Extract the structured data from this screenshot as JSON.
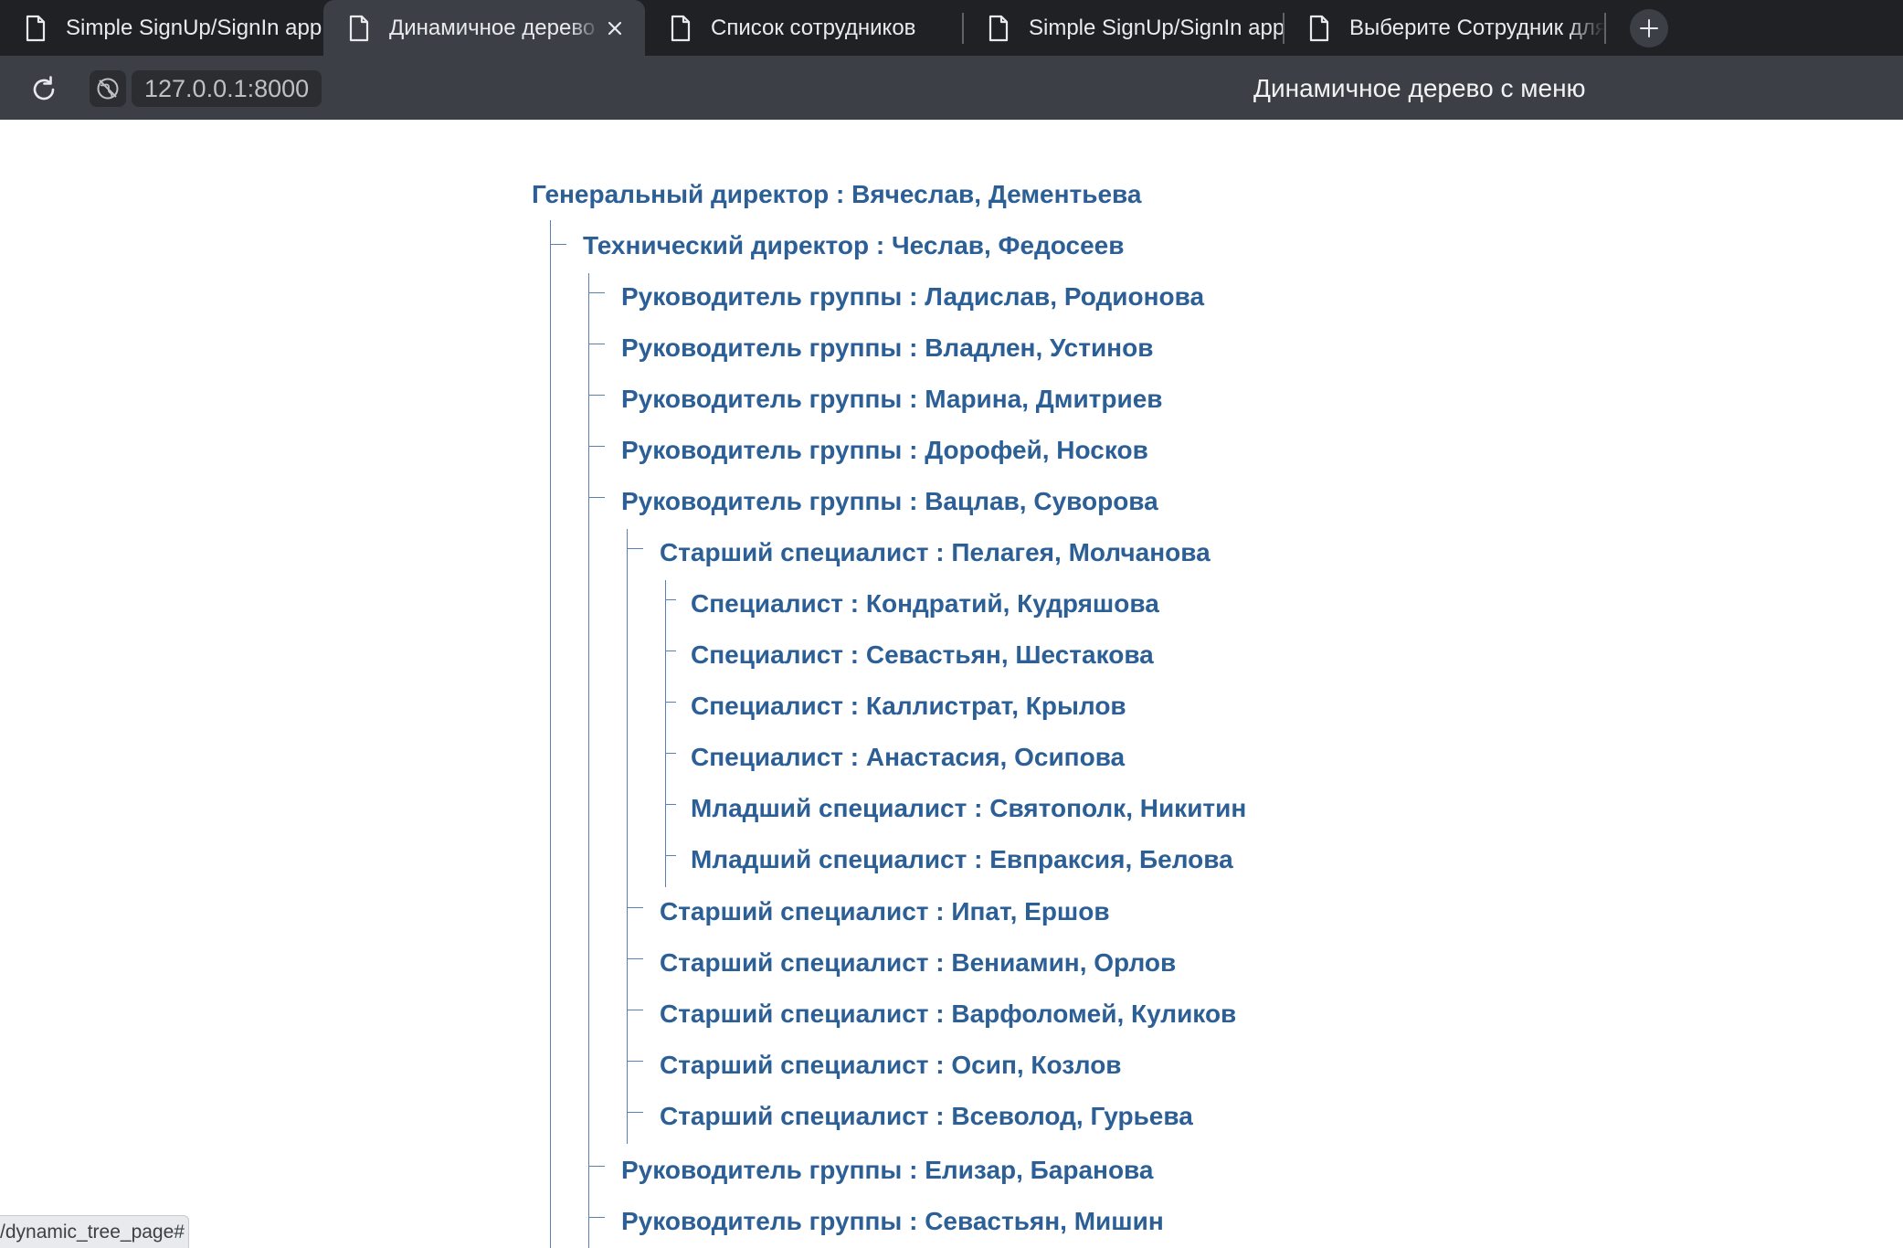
{
  "browser": {
    "tabs": [
      {
        "label": "Simple SignUp/SignIn app",
        "active": false
      },
      {
        "label": "Динамичное дерево с м",
        "active": true
      },
      {
        "label": "Список сотрудников",
        "active": false
      },
      {
        "label": "Simple SignUp/SignIn app",
        "active": false
      },
      {
        "label": "Выберите Сотрудник для и",
        "active": false
      }
    ],
    "url": "127.0.0.1:8000",
    "page_title": "Динамичное дерево с меню",
    "status_url": "/dynamic_tree_page#"
  },
  "tree": {
    "root": "Генеральный директор : Вячеслав, Дементьева",
    "cto": "Технический директор : Чеслав, Федосеев",
    "leads": [
      "Руководитель группы : Ладислав, Родионова",
      "Руководитель группы : Владлен, Устинов",
      "Руководитель группы : Марина, Дмитриев",
      "Руководитель группы : Дорофей, Носков",
      "Руководитель группы : Вацлав, Суворова"
    ],
    "seniors": [
      "Старший специалист : Пелагея, Молчанова",
      "Старший специалист : Ипат, Ершов",
      "Старший специалист : Вениамин, Орлов",
      "Старший специалист : Варфоломей, Куликов",
      "Старший специалист : Осип, Козлов",
      "Старший специалист : Всеволод, Гурьева"
    ],
    "specialists": [
      "Специалист : Кондратий, Кудряшова",
      "Специалист : Севастьян, Шестакова",
      "Специалист : Каллистрат, Крылов",
      "Специалист : Анастасия, Осипова",
      "Младший специалист : Святополк, Никитин",
      "Младший специалист : Евпраксия, Белова"
    ],
    "leads_after": [
      "Руководитель группы : Елизар, Баранова",
      "Руководитель группы : Севастьян, Мишин"
    ]
  },
  "colors": {
    "link": "#2c5f95",
    "tree_line": "#5a7fb0",
    "tab_strip": "#202124",
    "toolbar": "#3c3f45"
  }
}
